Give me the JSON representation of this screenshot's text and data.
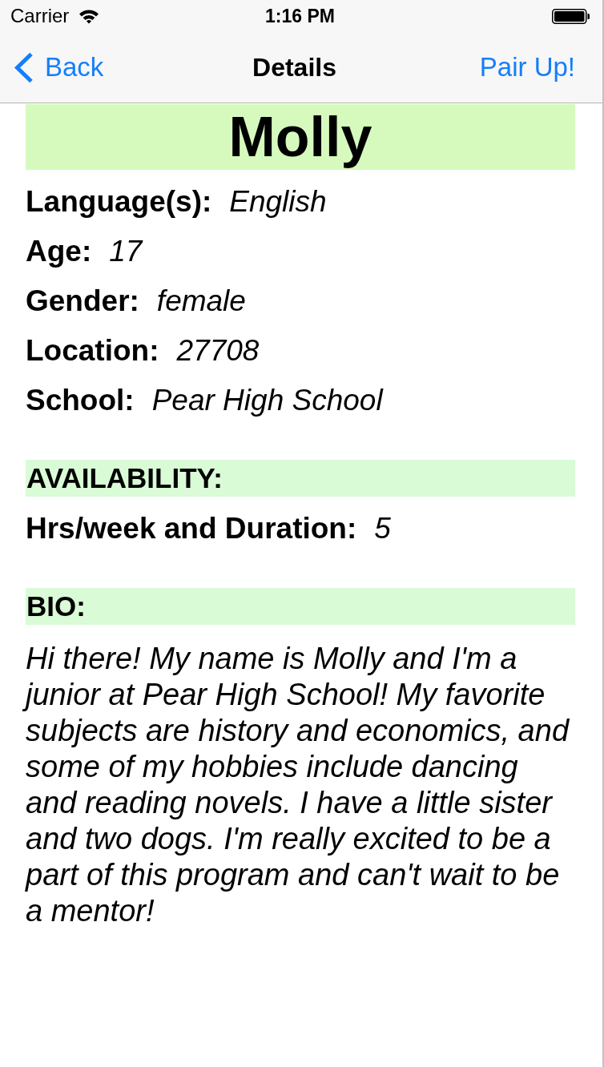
{
  "status_bar": {
    "carrier": "Carrier",
    "time": "1:16 PM"
  },
  "nav_bar": {
    "back": "Back",
    "title": "Details",
    "action": "Pair Up!"
  },
  "profile": {
    "name": "Molly",
    "fields": [
      {
        "label": "Language(s):",
        "value": "English"
      },
      {
        "label": "Age:",
        "value": "17"
      },
      {
        "label": "Gender:",
        "value": "female"
      },
      {
        "label": "Location:",
        "value": "27708"
      },
      {
        "label": "School:",
        "value": "Pear High School"
      }
    ]
  },
  "sections": [
    {
      "kind": "fields",
      "heading": "AVAILABILITY:",
      "fields": [
        {
          "label": "Hrs/week and Duration:",
          "value": "5"
        }
      ]
    },
    {
      "kind": "text",
      "heading": "BIO:",
      "text": "Hi there! My name is Molly and I'm a junior at Pear High School! My favorite subjects are history and economics, and some of my hobbies include dancing and reading novels. I have a little sister and two dogs. I'm really excited to be a part of this program and can't wait to be a mentor!"
    }
  ]
}
